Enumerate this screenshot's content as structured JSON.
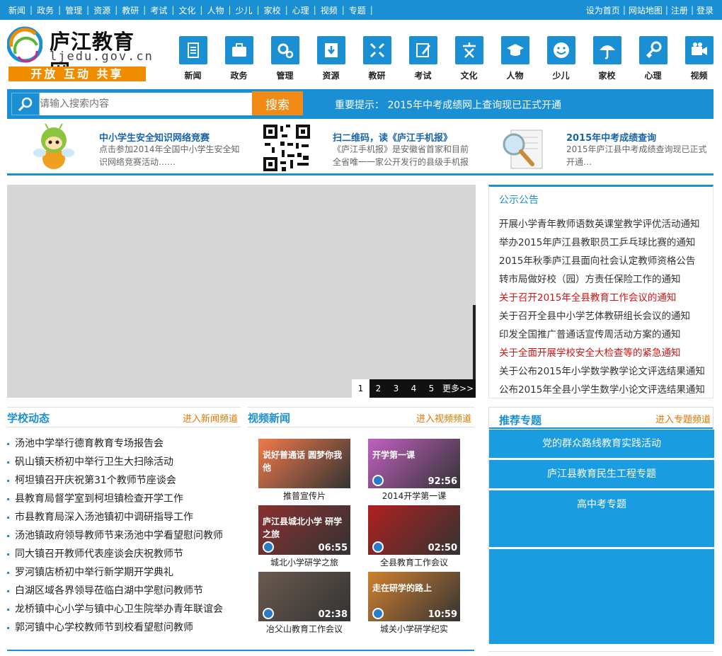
{
  "topnav": [
    "新闻",
    "政务",
    "管理",
    "资源",
    "教研",
    "考试",
    "文化",
    "人物",
    "少儿",
    "家校",
    "心理",
    "视频",
    "专题"
  ],
  "toplinks": [
    "设为首页",
    "网站地图",
    "注册",
    "登录"
  ],
  "logo": {
    "title": "庐江教育网",
    "url": "ljedu.gov.cn",
    "slogan": "开放 互动 共享"
  },
  "categories": [
    {
      "label": "新闻",
      "icon": "document-icon"
    },
    {
      "label": "政务",
      "icon": "briefcase-icon"
    },
    {
      "label": "管理",
      "icon": "gears-icon"
    },
    {
      "label": "资源",
      "icon": "download-icon"
    },
    {
      "label": "教研",
      "icon": "arrows-icon"
    },
    {
      "label": "考试",
      "icon": "pencil-icon"
    },
    {
      "label": "文化",
      "icon": "culture-icon"
    },
    {
      "label": "人物",
      "icon": "graduation-cap-icon"
    },
    {
      "label": "少儿",
      "icon": "smiley-icon"
    },
    {
      "label": "家校",
      "icon": "umbrella-icon"
    },
    {
      "label": "心理",
      "icon": "key-icon"
    },
    {
      "label": "视频",
      "icon": "video-camera-icon"
    }
  ],
  "search": {
    "placeholder": "请输入搜索内容",
    "button": "搜索",
    "notice": "重要提示： 2015年中考成绩网上查询现已正式开通"
  },
  "promos": [
    {
      "title": "中小学生安全知识网络竞赛",
      "desc1": "点击参加2014年全国中小学生安全知",
      "desc2": "识网络竞赛活动……"
    },
    {
      "title": "扫二维码，读《庐江手机报》",
      "desc1": "《庐江手机报》是安徽省首家和目前",
      "desc2": "全省唯一一家公开发行的县级手机报"
    },
    {
      "title": "2015年中考成绩查询",
      "desc1": "2015年庐江县中考成绩查询现已正式",
      "desc2": "开通…"
    }
  ],
  "slider": {
    "pages": [
      "1",
      "2",
      "3",
      "4",
      "5"
    ],
    "more": "更多>>"
  },
  "gonggao": {
    "title": "公示公告",
    "items": [
      {
        "text": "开展小学青年教师语数英课堂教学评优活动通知",
        "red": false
      },
      {
        "text": "举办2015年庐江县教职员工乒乓球比赛的通知",
        "red": false
      },
      {
        "text": "2015年秋季庐江县面向社会认定教师资格公告",
        "red": false
      },
      {
        "text": "转市局做好校（园）方责任保险工作的通知",
        "red": false
      },
      {
        "text": "关于召开2015年全县教育工作会议的通知",
        "red": true
      },
      {
        "text": "关于召开全县中小学艺体教研组长会议的通知",
        "red": false
      },
      {
        "text": "印发全国推广普通话宣传周活动方案的通知",
        "red": false
      },
      {
        "text": "关于全面开展学校安全大检查等的紧急通知",
        "red": true
      },
      {
        "text": "关于公布2015年小学数学教学论文评选结果通知",
        "red": false
      },
      {
        "text": "公布2015年全县小学生数学小论文评选结果通知",
        "red": false
      }
    ]
  },
  "school": {
    "title": "学校动态",
    "more": "进入新闻频道",
    "items": [
      "汤池中学举行德育教育专场报告会",
      "矾山镇天桥初中举行卫生大扫除活动",
      "柯坦镇召开庆祝第31个教师节座谈会",
      "县教育局督学室到柯坦镇检查开学工作",
      "市县教育局深入汤池镇初中调研指导工作",
      "汤池镇政府领导教师节来汤池中学看望慰问教师",
      "同大镇召开教师代表座谈会庆祝教师节",
      "罗河镇店桥初中举行新学期开学典礼",
      "白湖区域各界领导莅临白湖中学慰问教师节",
      "龙桥镇中心小学与镇中心卫生院举办青年联谊会",
      "郭河镇中心学校教师节到校看望慰问教师"
    ]
  },
  "video": {
    "title": "视频新闻",
    "more": "进入视频频道",
    "items": [
      {
        "caption": "推普宣传片",
        "duration": "",
        "thumb_text": "说好普通话 圆梦你我他",
        "color": "#f07a4a"
      },
      {
        "caption": "2014开学第一课",
        "duration": "92:56",
        "thumb_text": "开学第一课",
        "color": "#c060c0"
      },
      {
        "caption": "城北小学研学之旅",
        "duration": "06:55",
        "thumb_text": "庐江县城北小学 研学之旅",
        "color": "#8a3030"
      },
      {
        "caption": "全县教育工作会议",
        "duration": "02:50",
        "thumb_text": "",
        "color": "#b02020"
      },
      {
        "caption": "冶父山教育工作会议",
        "duration": "02:38",
        "thumb_text": "",
        "color": "#6a5a50"
      },
      {
        "caption": "城关小学研学纪实",
        "duration": "10:59",
        "thumb_text": "走在研学的路上",
        "color": "#d08030"
      }
    ]
  },
  "topics": {
    "title": "推荐专题",
    "more": "进入专题频道",
    "items": [
      "党的群众路线教育实践活动",
      "庐江县教育民生工程专题",
      "高中考专题"
    ]
  },
  "colors": {
    "accent": "#1a8fd3",
    "orange": "#f28b15",
    "alert": "#d01313"
  }
}
